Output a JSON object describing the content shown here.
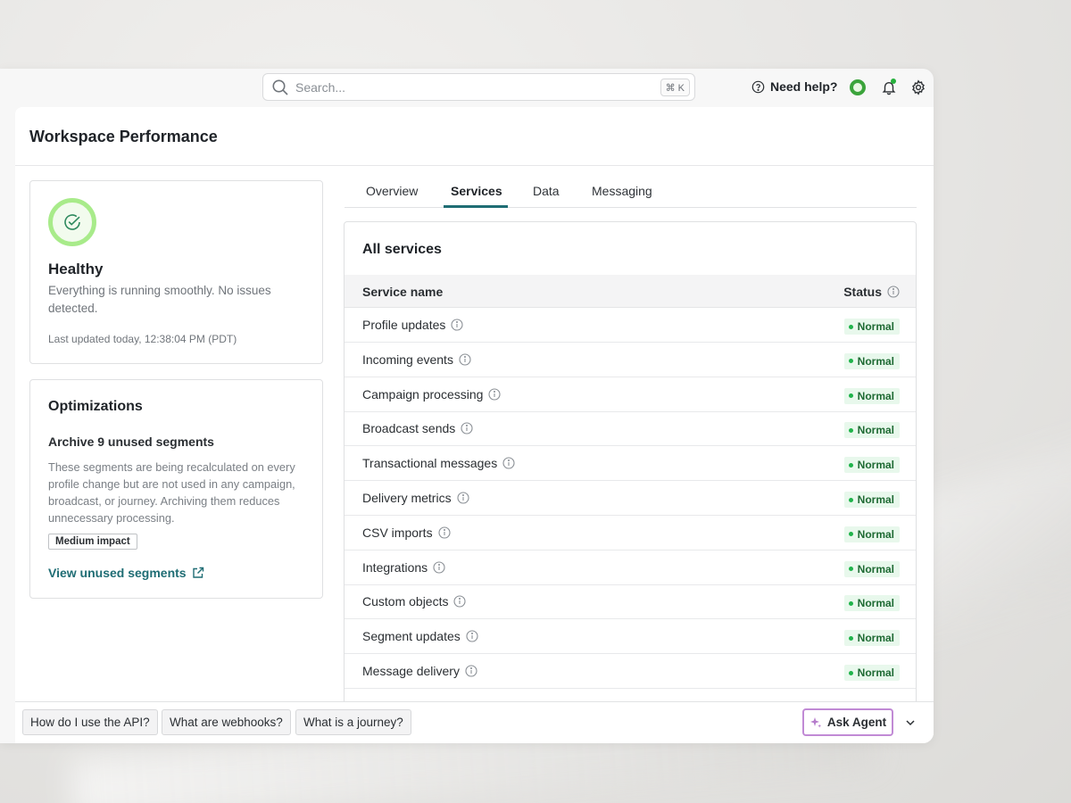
{
  "search": {
    "placeholder": "Search...",
    "shortcut": "⌘ K"
  },
  "header": {
    "help_label": "Need help?"
  },
  "page": {
    "title": "Workspace Performance"
  },
  "health": {
    "title": "Healthy",
    "description": "Everything is running smoothly. No issues detected.",
    "updated": "Last updated today, 12:38:04 PM (PDT)"
  },
  "optimizations": {
    "title": "Optimizations",
    "item_title": "Archive 9 unused segments",
    "item_description": "These segments are being recalculated on every profile change but are not used in any campaign, broadcast, or journey. Archiving them reduces unnecessary processing.",
    "impact": "Medium impact",
    "link_label": "View unused segments"
  },
  "tabs": [
    {
      "label": "Overview"
    },
    {
      "label": "Services"
    },
    {
      "label": "Data"
    },
    {
      "label": "Messaging"
    }
  ],
  "services": {
    "title": "All services",
    "col_name": "Service name",
    "col_status": "Status",
    "rows": [
      {
        "name": "Profile updates",
        "status": "Normal"
      },
      {
        "name": "Incoming events",
        "status": "Normal"
      },
      {
        "name": "Campaign processing",
        "status": "Normal"
      },
      {
        "name": "Broadcast sends",
        "status": "Normal"
      },
      {
        "name": "Transactional messages",
        "status": "Normal"
      },
      {
        "name": "Delivery metrics",
        "status": "Normal"
      },
      {
        "name": "CSV imports",
        "status": "Normal"
      },
      {
        "name": "Integrations",
        "status": "Normal"
      },
      {
        "name": "Custom objects",
        "status": "Normal"
      },
      {
        "name": "Segment updates",
        "status": "Normal"
      },
      {
        "name": "Message delivery",
        "status": "Normal"
      }
    ]
  },
  "suggestions": [
    {
      "label": "How do I use the API?"
    },
    {
      "label": "What are webhooks?"
    },
    {
      "label": "What is a journey?"
    }
  ],
  "agent": {
    "label": "Ask Agent"
  },
  "colors": {
    "accent": "#1f6d74",
    "healthy_ring": "#a8eb8a",
    "status_green": "#1fb34a",
    "agent_border": "#c18ad5"
  }
}
